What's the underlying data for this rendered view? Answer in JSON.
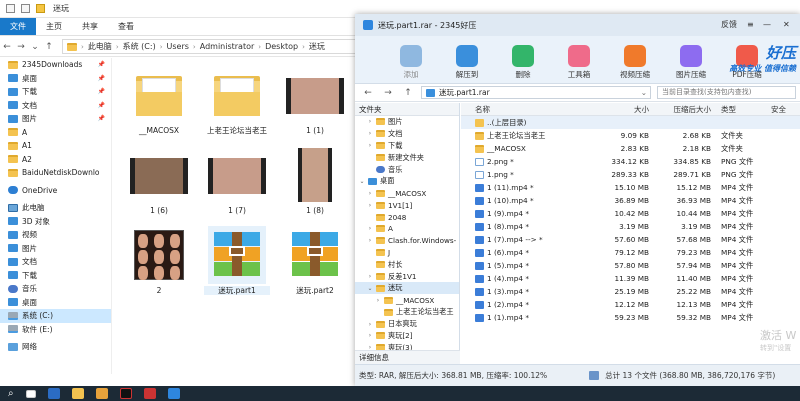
{
  "explorer": {
    "title": "迷玩",
    "ribbon_tabs": [
      "文件",
      "主页",
      "共享",
      "查看"
    ],
    "breadcrumb": [
      "此电脑",
      "系统 (C:)",
      "Users",
      "Administrator",
      "Desktop",
      "迷玩"
    ],
    "sidebar": [
      {
        "label": "2345Downloads",
        "icon": "folder-icon",
        "pinned": true
      },
      {
        "label": "桌面",
        "icon": "desktop-icon",
        "pinned": true
      },
      {
        "label": "下载",
        "icon": "download-icon",
        "pinned": true
      },
      {
        "label": "文档",
        "icon": "documents-icon",
        "pinned": true
      },
      {
        "label": "图片",
        "icon": "pictures-icon",
        "pinned": true
      },
      {
        "label": "A",
        "icon": "folder-icon"
      },
      {
        "label": "A1",
        "icon": "folder-icon"
      },
      {
        "label": "A2",
        "icon": "folder-icon"
      },
      {
        "label": "BaiduNetdiskDownlo",
        "icon": "folder-icon"
      },
      {
        "label": "OneDrive",
        "icon": "onedrive-icon",
        "gap": true
      },
      {
        "label": "此电脑",
        "icon": "pc-icon",
        "gap": true
      },
      {
        "label": "3D 对象",
        "icon": "3d-icon"
      },
      {
        "label": "视频",
        "icon": "video-icon"
      },
      {
        "label": "图片",
        "icon": "pictures-icon"
      },
      {
        "label": "文档",
        "icon": "documents-icon"
      },
      {
        "label": "下载",
        "icon": "download-icon"
      },
      {
        "label": "音乐",
        "icon": "music-icon"
      },
      {
        "label": "桌面",
        "icon": "desktop-icon"
      },
      {
        "label": "系统 (C:)",
        "icon": "drive-icon",
        "selected": true
      },
      {
        "label": "软件 (E:)",
        "icon": "drive-icon"
      },
      {
        "label": "网络",
        "icon": "network-icon",
        "gap": true
      }
    ],
    "files": [
      {
        "name": "__MACOSX",
        "kind": "folder"
      },
      {
        "name": "上老王论坛当老王",
        "kind": "folder"
      },
      {
        "name": "1 (1)",
        "kind": "video-light"
      },
      {
        "name": "1 (6)",
        "kind": "video"
      },
      {
        "name": "1 (7)",
        "kind": "video-light"
      },
      {
        "name": "1 (8)",
        "kind": "video-tall"
      },
      {
        "name": "2",
        "kind": "collage"
      },
      {
        "name": "迷玩.part1",
        "kind": "rar",
        "selected": true
      },
      {
        "name": "迷玩.part2",
        "kind": "rar"
      }
    ]
  },
  "zip_window": {
    "title": "迷玩.part1.rar - 2345好压",
    "window_controls": {
      "feedback": "反馈",
      "menu": "≡",
      "minimize": "—",
      "close": "✕"
    },
    "toolbar": [
      {
        "label": "添加",
        "icon": "add-icon",
        "color": "#8fb8e0",
        "disabled": true
      },
      {
        "label": "解压到",
        "icon": "extract-icon",
        "color": "#3a8fdc"
      },
      {
        "label": "删除",
        "icon": "delete-icon",
        "color": "#33b56a"
      },
      {
        "label": "工具箱",
        "icon": "toolbox-icon",
        "color": "#ef6b8a"
      },
      {
        "label": "视频压缩",
        "icon": "video-compress-icon",
        "color": "#f07a2b"
      },
      {
        "label": "图片压缩",
        "icon": "image-compress-icon",
        "color": "#8d6cf0"
      },
      {
        "label": "PDF压缩",
        "icon": "pdf-compress-icon",
        "color": "#f05a4a"
      }
    ],
    "brand": {
      "title": "好压",
      "slogan": "高效专业 值得信赖"
    },
    "path": "迷玩.part1.rar",
    "search_placeholder": "当前目录查找(支持包内查找)",
    "tree_header": "文件夹",
    "tree": [
      {
        "label": "图片",
        "level": 1,
        "exp": "›"
      },
      {
        "label": "文档",
        "level": 1,
        "exp": "›"
      },
      {
        "label": "下载",
        "level": 1,
        "exp": "›"
      },
      {
        "label": "新建文件夹",
        "level": 1,
        "exp": ""
      },
      {
        "label": "音乐",
        "level": 1,
        "exp": ""
      },
      {
        "label": "桌面",
        "level": 0,
        "exp": "⌄"
      },
      {
        "label": "__MACOSX",
        "level": 1,
        "exp": "›"
      },
      {
        "label": "1V1[1]",
        "level": 1,
        "exp": "›"
      },
      {
        "label": "2048",
        "level": 1,
        "exp": ""
      },
      {
        "label": "A",
        "level": 1,
        "exp": "›"
      },
      {
        "label": "Clash.for.Windows-",
        "level": 1,
        "exp": "›"
      },
      {
        "label": "J",
        "level": 1,
        "exp": ""
      },
      {
        "label": "村长",
        "level": 1,
        "exp": ""
      },
      {
        "label": "反差1V1",
        "level": 1,
        "exp": "›"
      },
      {
        "label": "迷玩",
        "level": 1,
        "exp": "⌄",
        "selected": true
      },
      {
        "label": "__MACOSX",
        "level": 2,
        "exp": "›"
      },
      {
        "label": "上老王论坛当老王",
        "level": 2,
        "exp": ""
      },
      {
        "label": "日本爽玩",
        "level": 1,
        "exp": "›"
      },
      {
        "label": "爽玩[2]",
        "level": 1,
        "exp": "›"
      },
      {
        "label": "爽玩(3)",
        "level": 1,
        "exp": "›"
      }
    ],
    "detail_btn": "详细信息",
    "columns": [
      "名称",
      "大小",
      "压缩后大小",
      "类型",
      "安全"
    ],
    "rows": [
      {
        "name": "..(上层目录)",
        "size": "",
        "packed": "",
        "type": "",
        "kind": "up",
        "selected": true
      },
      {
        "name": "上老王论坛当老王",
        "size": "9.09 KB",
        "packed": "2.68 KB",
        "type": "文件夹",
        "kind": "folder"
      },
      {
        "name": "__MACOSX",
        "size": "2.83 KB",
        "packed": "2.18 KB",
        "type": "文件夹",
        "kind": "folder"
      },
      {
        "name": "2.png *",
        "size": "334.12 KB",
        "packed": "334.85 KB",
        "type": "PNG 文件",
        "kind": "img"
      },
      {
        "name": "1.png *",
        "size": "289.33 KB",
        "packed": "289.71 KB",
        "type": "PNG 文件",
        "kind": "img"
      },
      {
        "name": "1 (11).mp4 *",
        "size": "15.10 MB",
        "packed": "15.12 MB",
        "type": "MP4 文件",
        "kind": "vid"
      },
      {
        "name": "1 (10).mp4 *",
        "size": "36.89 MB",
        "packed": "36.93 MB",
        "type": "MP4 文件",
        "kind": "vid"
      },
      {
        "name": "1 (9).mp4 *",
        "size": "10.42 MB",
        "packed": "10.44 MB",
        "type": "MP4 文件",
        "kind": "vid"
      },
      {
        "name": "1 (8).mp4 *",
        "size": "3.19 MB",
        "packed": "3.19 MB",
        "type": "MP4 文件",
        "kind": "vid"
      },
      {
        "name": "1 (7).mp4 --> *",
        "size": "57.60 MB",
        "packed": "57.68 MB",
        "type": "MP4 文件",
        "kind": "vid"
      },
      {
        "name": "1 (6).mp4 *",
        "size": "79.12 MB",
        "packed": "79.23 MB",
        "type": "MP4 文件",
        "kind": "vid"
      },
      {
        "name": "1 (5).mp4 *",
        "size": "57.80 MB",
        "packed": "57.94 MB",
        "type": "MP4 文件",
        "kind": "vid"
      },
      {
        "name": "1 (4).mp4 *",
        "size": "11.39 MB",
        "packed": "11.40 MB",
        "type": "MP4 文件",
        "kind": "vid"
      },
      {
        "name": "1 (3).mp4 *",
        "size": "25.19 MB",
        "packed": "25.22 MB",
        "type": "MP4 文件",
        "kind": "vid"
      },
      {
        "name": "1 (2).mp4 *",
        "size": "12.12 MB",
        "packed": "12.13 MB",
        "type": "MP4 文件",
        "kind": "vid"
      },
      {
        "name": "1 (1).mp4 *",
        "size": "59.23 MB",
        "packed": "59.32 MB",
        "type": "MP4 文件",
        "kind": "vid"
      }
    ],
    "status_left": "类型: RAR, 解压后大小: 368.81 MB, 压缩率: 100.12%",
    "status_right": "总计 13 个文件 (368.80 MB, 386,720,176 字节)"
  },
  "watermark": {
    "line1": "激活 W",
    "line2": "转到\"设置"
  }
}
